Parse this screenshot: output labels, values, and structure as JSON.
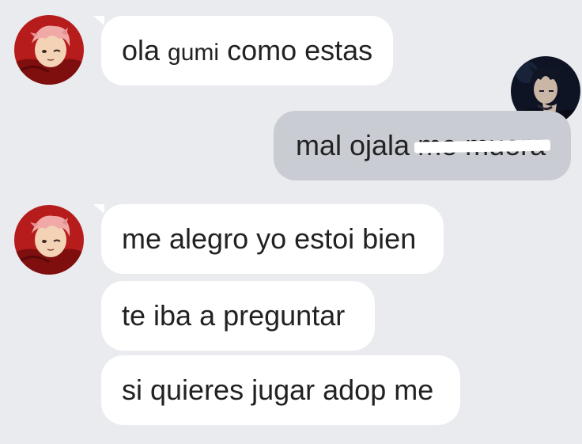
{
  "messages": [
    {
      "id": "m1",
      "sender": "incoming",
      "avatar": "pink-haired-character-avatar",
      "text_before": "ola ",
      "text_small": "gumi",
      "text_after": " como estas"
    },
    {
      "id": "m2",
      "sender": "outgoing",
      "avatar": "dark-haired-character-avatar",
      "text": "mal ojala ",
      "struck_text": "me muera"
    },
    {
      "id": "m3",
      "sender": "incoming",
      "avatar": "pink-haired-character-avatar",
      "text": "me alegro yo estoi bien"
    },
    {
      "id": "m4",
      "sender": "incoming",
      "text": "te iba a preguntar"
    },
    {
      "id": "m5",
      "sender": "incoming",
      "text": "si quieres jugar adop me"
    }
  ],
  "colors": {
    "background": "#e9ebee",
    "incoming_bubble": "#ffffff",
    "outgoing_bubble": "#c9ccd3",
    "text": "#222222"
  }
}
